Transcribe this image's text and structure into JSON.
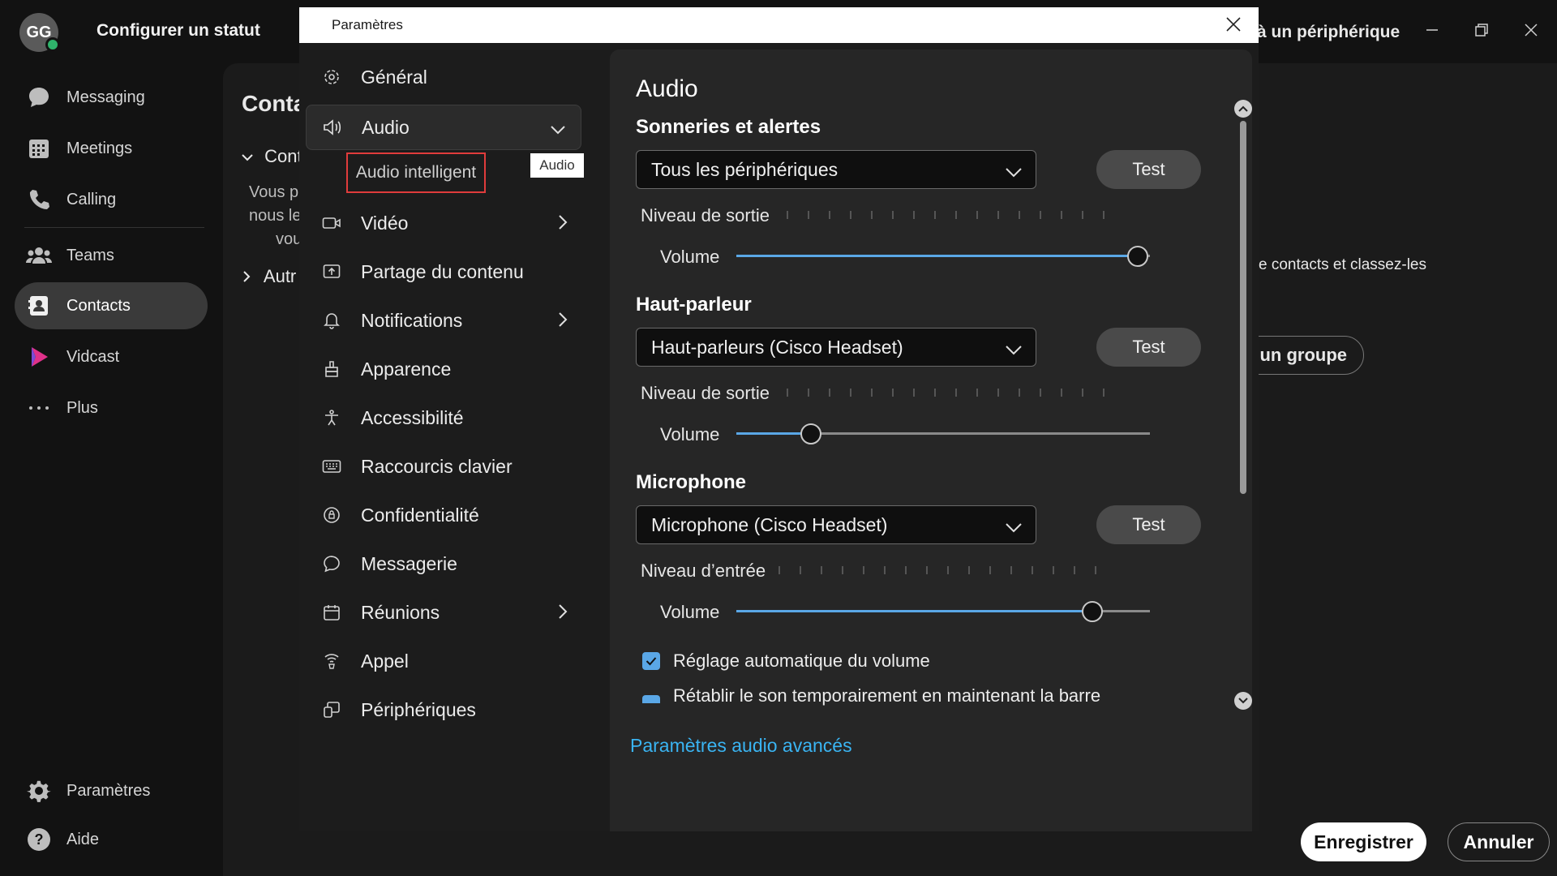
{
  "app": {
    "avatar_initials": "GG",
    "status_title": "Configurer un statut",
    "nav": [
      {
        "label": "Messaging",
        "icon": "chat-bubble-icon"
      },
      {
        "label": "Meetings",
        "icon": "calendar-grid-icon"
      },
      {
        "label": "Calling",
        "icon": "phone-icon"
      },
      {
        "label": "Teams",
        "icon": "people-icon"
      },
      {
        "label": "Contacts",
        "icon": "contact-card-icon"
      },
      {
        "label": "Vidcast",
        "icon": "vidcast-icon"
      },
      {
        "label": "Plus",
        "icon": "more-dots-icon"
      }
    ],
    "bottom_nav": [
      {
        "label": "Paramètres",
        "icon": "gear-icon"
      },
      {
        "label": "Aide",
        "icon": "help-icon"
      }
    ],
    "background": {
      "title": "Conta",
      "section1": "Cont",
      "desc1": "Vous p",
      "desc2": "nous le",
      "desc3": "vou",
      "section2": "Autr",
      "right_header": "à un périphérique",
      "right_text": "e contacts et classez-les",
      "right_button": "un groupe"
    }
  },
  "dialog": {
    "title": "Paramètres",
    "nav": {
      "general": "Général",
      "audio": "Audio",
      "audio_sub": "Audio intelligent",
      "tooltip": "Audio",
      "video": "Vidéo",
      "sharing": "Partage du contenu",
      "notifications": "Notifications",
      "appearance": "Apparence",
      "accessibility": "Accessibilité",
      "shortcuts": "Raccourcis clavier",
      "privacy": "Confidentialité",
      "messaging": "Messagerie",
      "meetings": "Réunions",
      "calling": "Appel",
      "devices": "Périphériques"
    },
    "content": {
      "title": "Audio",
      "ringers": {
        "heading": "Sonneries et alertes",
        "device": "Tous les périphériques",
        "test": "Test",
        "level_label": "Niveau de sortie",
        "volume_label": "Volume",
        "volume": 0.97
      },
      "speaker": {
        "heading": "Haut-parleur",
        "device": "Haut-parleurs (Cisco Headset)",
        "test": "Test",
        "level_label": "Niveau de sortie",
        "volume_label": "Volume",
        "volume": 0.18
      },
      "microphone": {
        "heading": "Microphone",
        "device": "Microphone (Cisco Headset)",
        "test": "Test",
        "level_label": "Niveau d’entrée",
        "volume_label": "Volume",
        "volume": 0.86
      },
      "auto_volume": "Réglage automatique du volume",
      "unmute_hold": "Rétablir le son temporairement en maintenant la barre",
      "advanced_link": "Paramètres audio avancés",
      "save": "Enregistrer",
      "cancel": "Annuler"
    }
  },
  "colors": {
    "accent": "#5aa7e6",
    "link": "#3ab4f2",
    "highlight_border": "#e03c3c",
    "presence": "#2fb36b"
  }
}
